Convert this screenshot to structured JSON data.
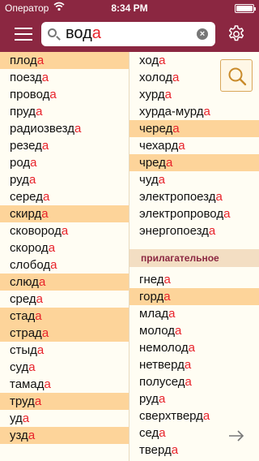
{
  "status_bar": {
    "carrier": "Оператор",
    "time": "8:34 PM"
  },
  "search": {
    "query_stem": "вод",
    "query_suffix": "а"
  },
  "left_list": [
    {
      "stem": "плод",
      "suffix": "а",
      "shaded": true
    },
    {
      "stem": "поезд",
      "suffix": "а",
      "shaded": false
    },
    {
      "stem": "провод",
      "suffix": "а",
      "shaded": false
    },
    {
      "stem": "пруд",
      "suffix": "а",
      "shaded": false
    },
    {
      "stem": "радиозвезд",
      "suffix": "а",
      "shaded": false
    },
    {
      "stem": "резед",
      "suffix": "а",
      "shaded": false
    },
    {
      "stem": "род",
      "suffix": "а",
      "shaded": false
    },
    {
      "stem": "руд",
      "suffix": "а",
      "shaded": false
    },
    {
      "stem": "серед",
      "suffix": "а",
      "shaded": false
    },
    {
      "stem": "скирд",
      "suffix": "а",
      "shaded": true
    },
    {
      "stem": "сковород",
      "suffix": "а",
      "shaded": false
    },
    {
      "stem": "скород",
      "suffix": "а",
      "shaded": false
    },
    {
      "stem": "слобод",
      "suffix": "а",
      "shaded": false
    },
    {
      "stem": "слюд",
      "suffix": "а",
      "shaded": true
    },
    {
      "stem": "сред",
      "suffix": "а",
      "shaded": false
    },
    {
      "stem": "стад",
      "suffix": "а",
      "shaded": true
    },
    {
      "stem": "страд",
      "suffix": "а",
      "shaded": true
    },
    {
      "stem": "стыд",
      "suffix": "а",
      "shaded": false
    },
    {
      "stem": "суд",
      "suffix": "а",
      "shaded": false
    },
    {
      "stem": "тамад",
      "suffix": "а",
      "shaded": false
    },
    {
      "stem": "труд",
      "suffix": "а",
      "shaded": true
    },
    {
      "stem": "уд",
      "suffix": "а",
      "shaded": false
    },
    {
      "stem": "узд",
      "suffix": "а",
      "shaded": true
    }
  ],
  "right_list_top": [
    {
      "stem": "ход",
      "suffix": "а",
      "shaded": false
    },
    {
      "stem": "холод",
      "suffix": "а",
      "shaded": false
    },
    {
      "stem": "хурд",
      "suffix": "а",
      "shaded": false
    },
    {
      "stem": "хурда-мурд",
      "suffix": "а",
      "shaded": false
    },
    {
      "stem": "черед",
      "suffix": "а",
      "shaded": true
    },
    {
      "stem": "чехард",
      "suffix": "а",
      "shaded": false
    },
    {
      "stem": "чред",
      "suffix": "а",
      "shaded": true
    },
    {
      "stem": "чуд",
      "suffix": "а",
      "shaded": false
    },
    {
      "stem": "электропоезд",
      "suffix": "а",
      "shaded": false
    },
    {
      "stem": "электропровод",
      "suffix": "а",
      "shaded": false
    },
    {
      "stem": "энергопоезд",
      "suffix": "а",
      "shaded": false
    }
  ],
  "section_header": "прилагательное",
  "right_list_bottom": [
    {
      "stem": "гнед",
      "suffix": "а",
      "shaded": false
    },
    {
      "stem": "горд",
      "suffix": "а",
      "shaded": true
    },
    {
      "stem": "млад",
      "suffix": "а",
      "shaded": false
    },
    {
      "stem": "молод",
      "suffix": "а",
      "shaded": false
    },
    {
      "stem": "немолод",
      "suffix": "а",
      "shaded": false
    },
    {
      "stem": "нетверд",
      "suffix": "а",
      "shaded": false
    },
    {
      "stem": "полусед",
      "suffix": "а",
      "shaded": false
    },
    {
      "stem": "руд",
      "suffix": "а",
      "shaded": false
    },
    {
      "stem": "сверхтверд",
      "suffix": "а",
      "shaded": false
    },
    {
      "stem": "сед",
      "suffix": "а",
      "shaded": false
    },
    {
      "stem": "тверд",
      "suffix": "а",
      "shaded": false
    }
  ],
  "icons": {
    "menu": "hamburger-menu-icon",
    "search": "search-icon",
    "clear": "clear-icon",
    "settings": "gear-icon",
    "lookup": "magnifier-icon",
    "next": "arrow-right-icon",
    "wifi": "wifi-icon",
    "battery": "battery-icon"
  },
  "colors": {
    "header": "#8b2741",
    "highlight_row": "#fdd49a",
    "suffix": "#e8232b",
    "section_header_bg": "#f3dec3",
    "background": "#fffdf3"
  }
}
